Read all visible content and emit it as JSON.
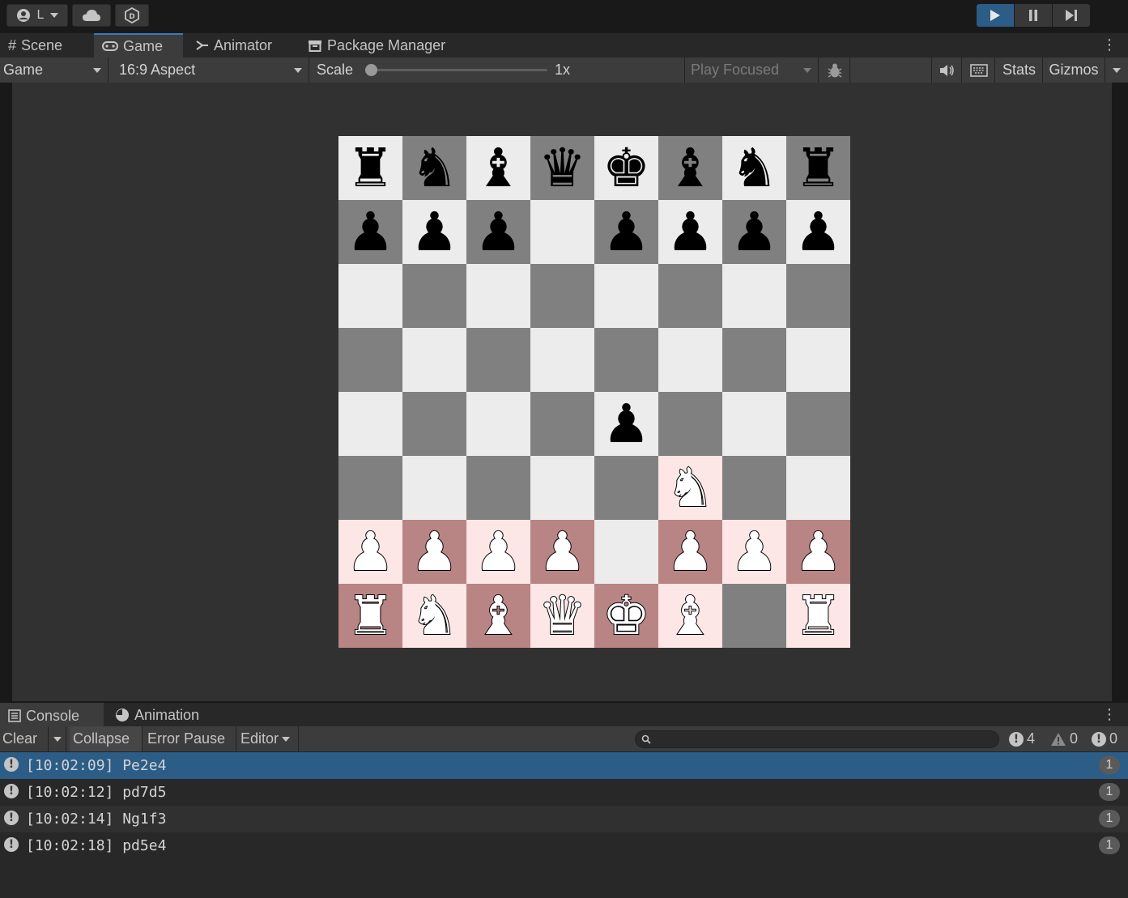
{
  "toolbar": {
    "account_label": "L",
    "account_icon": "account-icon",
    "cloud_icon": "cloud-icon",
    "collab_icon": "collab-icon",
    "play_active_color": "#2c5d87"
  },
  "editor_tabs": [
    {
      "label": "Scene",
      "icon": "grid-icon"
    },
    {
      "label": "Game",
      "icon": "gamepad-icon",
      "active": true
    },
    {
      "label": "Animator",
      "icon": "animator-icon"
    },
    {
      "label": "Package Manager",
      "icon": "package-icon"
    }
  ],
  "game_toolbar": {
    "display": "Game",
    "aspect": "16:9 Aspect",
    "scale_label": "Scale",
    "scale_value": "1x",
    "play_mode": "Play Focused",
    "stats_label": "Stats",
    "gizmos_label": "Gizmos"
  },
  "board": {
    "colors": {
      "light": "#ececec",
      "dark": "#808080",
      "highlight_light": "#fde6e6",
      "highlight_dark": "#b98484"
    },
    "ranks": [
      [
        "r",
        "n",
        "b",
        "q",
        "k",
        "b",
        "n",
        "r"
      ],
      [
        "p",
        "p",
        "p",
        "",
        "p",
        "p",
        "p",
        "p"
      ],
      [
        "",
        "",
        "",
        "",
        "",
        "",
        "",
        ""
      ],
      [
        "",
        "",
        "",
        "",
        "",
        "",
        "",
        ""
      ],
      [
        "",
        "",
        "",
        "",
        "p",
        "",
        "",
        ""
      ],
      [
        "",
        "",
        "",
        "",
        "",
        "N",
        "",
        ""
      ],
      [
        "P",
        "P",
        "P",
        "P",
        "",
        "P",
        "P",
        "P"
      ],
      [
        "R",
        "N",
        "B",
        "Q",
        "K",
        "B",
        "",
        "R"
      ]
    ],
    "highlighted": [
      "f3",
      "a2",
      "b2",
      "c2",
      "d2",
      "f2",
      "g2",
      "h2",
      "a1",
      "b1",
      "c1",
      "d1",
      "e1",
      "f1",
      "h1"
    ]
  },
  "console_tabs": [
    {
      "label": "Console",
      "icon": "console-icon",
      "active": true
    },
    {
      "label": "Animation",
      "icon": "animation-icon"
    }
  ],
  "console_toolbar": {
    "clear": "Clear",
    "collapse": "Collapse",
    "error_pause": "Error Pause",
    "editor": "Editor",
    "info_count": "4",
    "warning_count": "0",
    "error_count": "0"
  },
  "log": [
    {
      "time": "[10:02:09]",
      "message": "Pe2e4",
      "count": "1",
      "selected": true
    },
    {
      "time": "[10:02:12]",
      "message": "pd7d5",
      "count": "1"
    },
    {
      "time": "[10:02:14]",
      "message": "Ng1f3",
      "count": "1"
    },
    {
      "time": "[10:02:18]",
      "message": "pd5e4",
      "count": "1"
    }
  ]
}
